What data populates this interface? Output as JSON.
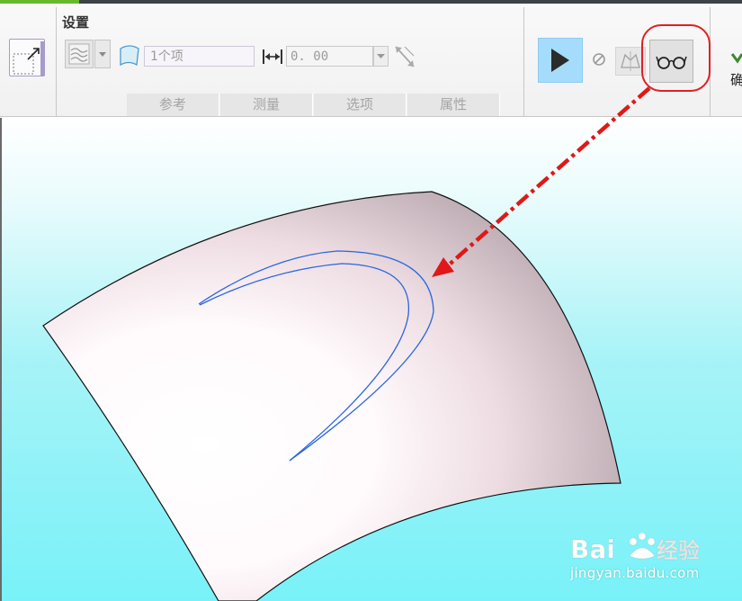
{
  "ribbon": {
    "section_title": "设置",
    "items_field": {
      "value": "1个项"
    },
    "thickness": {
      "value": "0. 00"
    },
    "tabs": [
      {
        "label": "参考"
      },
      {
        "label": "测量"
      },
      {
        "label": "选项"
      },
      {
        "label": "属性"
      }
    ],
    "ok_label": "确"
  },
  "icons": {
    "quilt": "quilt-icon",
    "surface_type": "surface-type-icon",
    "surface_collector": "surface-collector-icon",
    "thickness": "dimension-arrows-icon",
    "flip": "flip-direction-icon",
    "play": "play-icon",
    "pause": "pause-icon",
    "verify": "verify-icon",
    "preview": "glasses-icon",
    "ok": "checkmark-icon"
  },
  "colors": {
    "play_active": "#a6dcfb",
    "highlight_annotation": "#e02020",
    "curve": "#2a66e0",
    "background_bottom": "#78f2f8"
  },
  "watermark": {
    "url": "jingyan.baidu.com"
  }
}
